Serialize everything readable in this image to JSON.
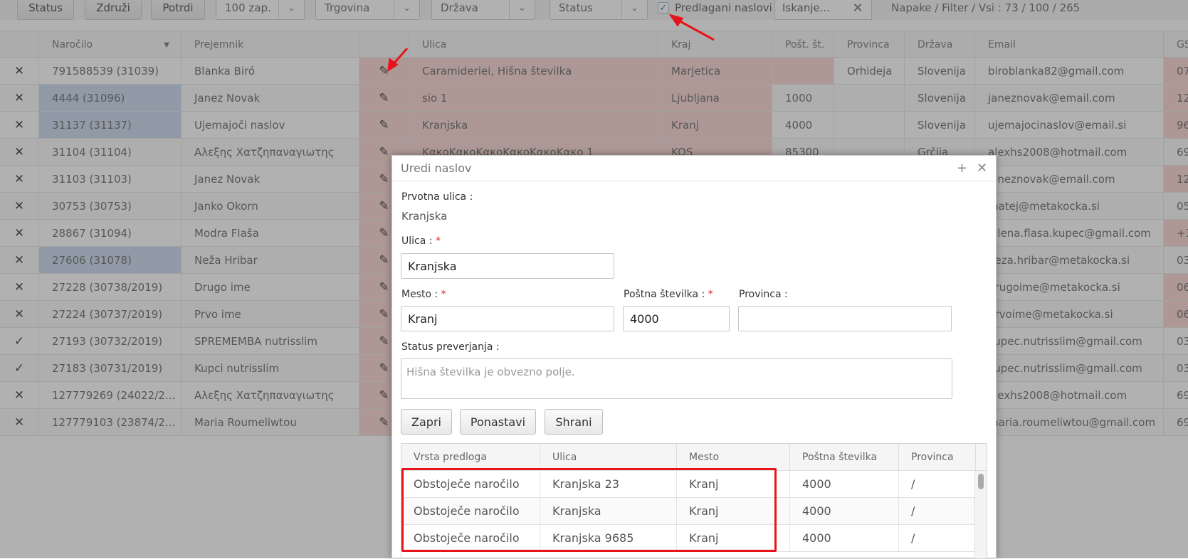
{
  "toolbar": {
    "status_btn": "Status",
    "merge_btn": "Združi",
    "confirm_btn": "Potrdi",
    "page_size": "100 zap.",
    "shop_filter": "Trgovina",
    "country_filter": "Država",
    "status_filter": "Status",
    "suggested_label": "Predlagani naslovi",
    "search_placeholder": "Iskanje...",
    "stats": "Napake / Filter / Vsi : 73 / 100 / 265"
  },
  "grid": {
    "headers": [
      "Naročilo",
      "Prejemnik",
      "",
      "Ulica",
      "Kraj",
      "Pošt. št.",
      "Provinca",
      "Država",
      "Email",
      "GS"
    ],
    "rows": [
      {
        "mark": "✕",
        "order": "791588539 (31039)",
        "recipient": "Blanka Biró",
        "street": "Caramideriei, Hišna številka",
        "city": "Marjetica",
        "zip": "",
        "province": "Orhideja",
        "country": "Slovenija",
        "email": "biroblanka82@gmail.com",
        "gs": "07"
      },
      {
        "mark": "✕",
        "order": "4444 (31096)",
        "recipient": "Janez Novak",
        "street": "sio 1",
        "city": "Ljubljana",
        "zip": "1000",
        "province": "",
        "country": "Slovenija",
        "email": "janeznovak@email.com",
        "gs": "12"
      },
      {
        "mark": "✕",
        "order": "31137 (31137)",
        "recipient": "Ujemajoči naslov",
        "street": "Kranjska",
        "city": "Kranj",
        "zip": "4000",
        "province": "",
        "country": "Slovenija",
        "email": "ujemajocinaslov@email.si",
        "gs": "96"
      },
      {
        "mark": "✕",
        "order": "31104 (31104)",
        "recipient": "Αλεξης Χατζηπαναγιωτης",
        "street": "ΚακοΚακοΚακοΚακοΚακοΚακο 1",
        "city": "KOS",
        "zip": "85300",
        "province": "",
        "country": "Grčija",
        "email": "alexhs2008@hotmail.com",
        "gs": "69"
      },
      {
        "mark": "✕",
        "order": "31103 (31103)",
        "recipient": "Janez Novak",
        "street": "",
        "city": "",
        "zip": "",
        "province": "",
        "country": "",
        "email": "janeznovak@email.com",
        "gs": "12"
      },
      {
        "mark": "✕",
        "order": "30753 (30753)",
        "recipient": "Janko Okorn",
        "street": "",
        "city": "",
        "zip": "",
        "province": "",
        "country": "",
        "email": "matej@metakocka.si",
        "gs": "05"
      },
      {
        "mark": "✕",
        "order": "28867 (31094)",
        "recipient": "Modra Flaša",
        "street": "",
        "city": "",
        "zip": "",
        "province": "",
        "country": "",
        "email": "jelena.flasa.kupec@gmail.com",
        "gs": "+3"
      },
      {
        "mark": "✕",
        "order": "27606 (31078)",
        "recipient": "Neža Hribar",
        "street": "",
        "city": "",
        "zip": "",
        "province": "",
        "country": "",
        "email": "neza.hribar@metakocka.si",
        "gs": "03"
      },
      {
        "mark": "✕",
        "order": "27228 (30738/2019)",
        "recipient": "Drugo ime",
        "street": "",
        "city": "",
        "zip": "",
        "province": "",
        "country": "",
        "email": "drugoime@metakocka.si",
        "gs": "06"
      },
      {
        "mark": "✕",
        "order": "27224 (30737/2019)",
        "recipient": "Prvo ime",
        "street": "",
        "city": "",
        "zip": "",
        "province": "",
        "country": "",
        "email": "prvoime@metakocka.si",
        "gs": "06"
      },
      {
        "mark": "✓",
        "order": "27193 (30732/2019)",
        "recipient": "SPREMEMBA nutrisslim",
        "street": "",
        "city": "",
        "zip": "",
        "province": "",
        "country": "",
        "email": "kupec.nutrisslim@gmail.com",
        "gs": "03"
      },
      {
        "mark": "✓",
        "order": "27183 (30731/2019)",
        "recipient": "Kupci nutrisslim",
        "street": "",
        "city": "",
        "zip": "",
        "province": "",
        "country": "",
        "email": "kupec.nutrisslim@gmail.com",
        "gs": "03"
      },
      {
        "mark": "✕",
        "order": "127779269 (24022/2...",
        "recipient": "Αλεξης Χατζηπαναγιωτης",
        "street": "",
        "city": "",
        "zip": "",
        "province": "",
        "country": "",
        "email": "alexhs2008@hotmail.com",
        "gs": "69"
      },
      {
        "mark": "✕",
        "order": "127779103 (23874/2...",
        "recipient": "Maria Roumeliwtou",
        "street": "",
        "city": "",
        "zip": "",
        "province": "",
        "country": "",
        "email": "maria.roumeliwtou@gmail.com",
        "gs": "69"
      }
    ]
  },
  "dialog": {
    "title": "Uredi naslov",
    "original_street_label": "Prvotna ulica :",
    "original_street_value": "Kranjska",
    "street_label": "Ulica :",
    "street_value": "Kranjska",
    "city_label": "Mesto :",
    "city_value": "Kranj",
    "zip_label": "Poštna številka :",
    "zip_value": "4000",
    "province_label": "Provinca :",
    "province_value": "",
    "status_label": "Status preverjanja :",
    "status_value": "Hišna številka je obvezno polje.",
    "close_btn": "Zapri",
    "reset_btn": "Ponastavi",
    "save_btn": "Shrani",
    "suggest_headers": [
      "Vrsta predloga",
      "Ulica",
      "Mesto",
      "Poštna številka",
      "Provinca"
    ],
    "suggestions": [
      {
        "type": "Obstoječe naročilo",
        "street": "Kranjska 23",
        "city": "Kranj",
        "zip": "4000",
        "province": "/"
      },
      {
        "type": "Obstoječe naročilo",
        "street": "Kranjska",
        "city": "Kranj",
        "zip": "4000",
        "province": "/"
      },
      {
        "type": "Obstoječe naročilo",
        "street": "Kranjska 9685",
        "city": "Kranj",
        "zip": "4000",
        "province": "/"
      }
    ]
  }
}
